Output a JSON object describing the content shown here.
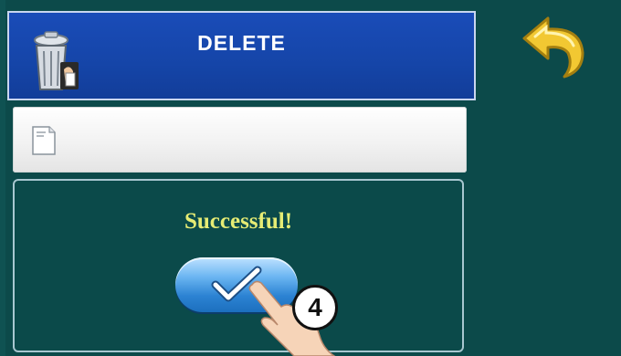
{
  "header": {
    "title": "DELETE",
    "icon": "trash-bin-icon"
  },
  "nav": {
    "back_icon": "back-arrow-icon"
  },
  "file_row": {
    "icon": "file-icon"
  },
  "dialog": {
    "message": "Successful!",
    "confirm_icon": "checkmark-icon"
  },
  "annotation": {
    "step_number": "4",
    "pointer_icon": "pointing-hand-icon"
  },
  "colors": {
    "background": "#0c4a4a",
    "header": "#1545a8",
    "message": "#e6ec74",
    "button": "#2c83d3",
    "back_arrow": "#f2c832"
  }
}
